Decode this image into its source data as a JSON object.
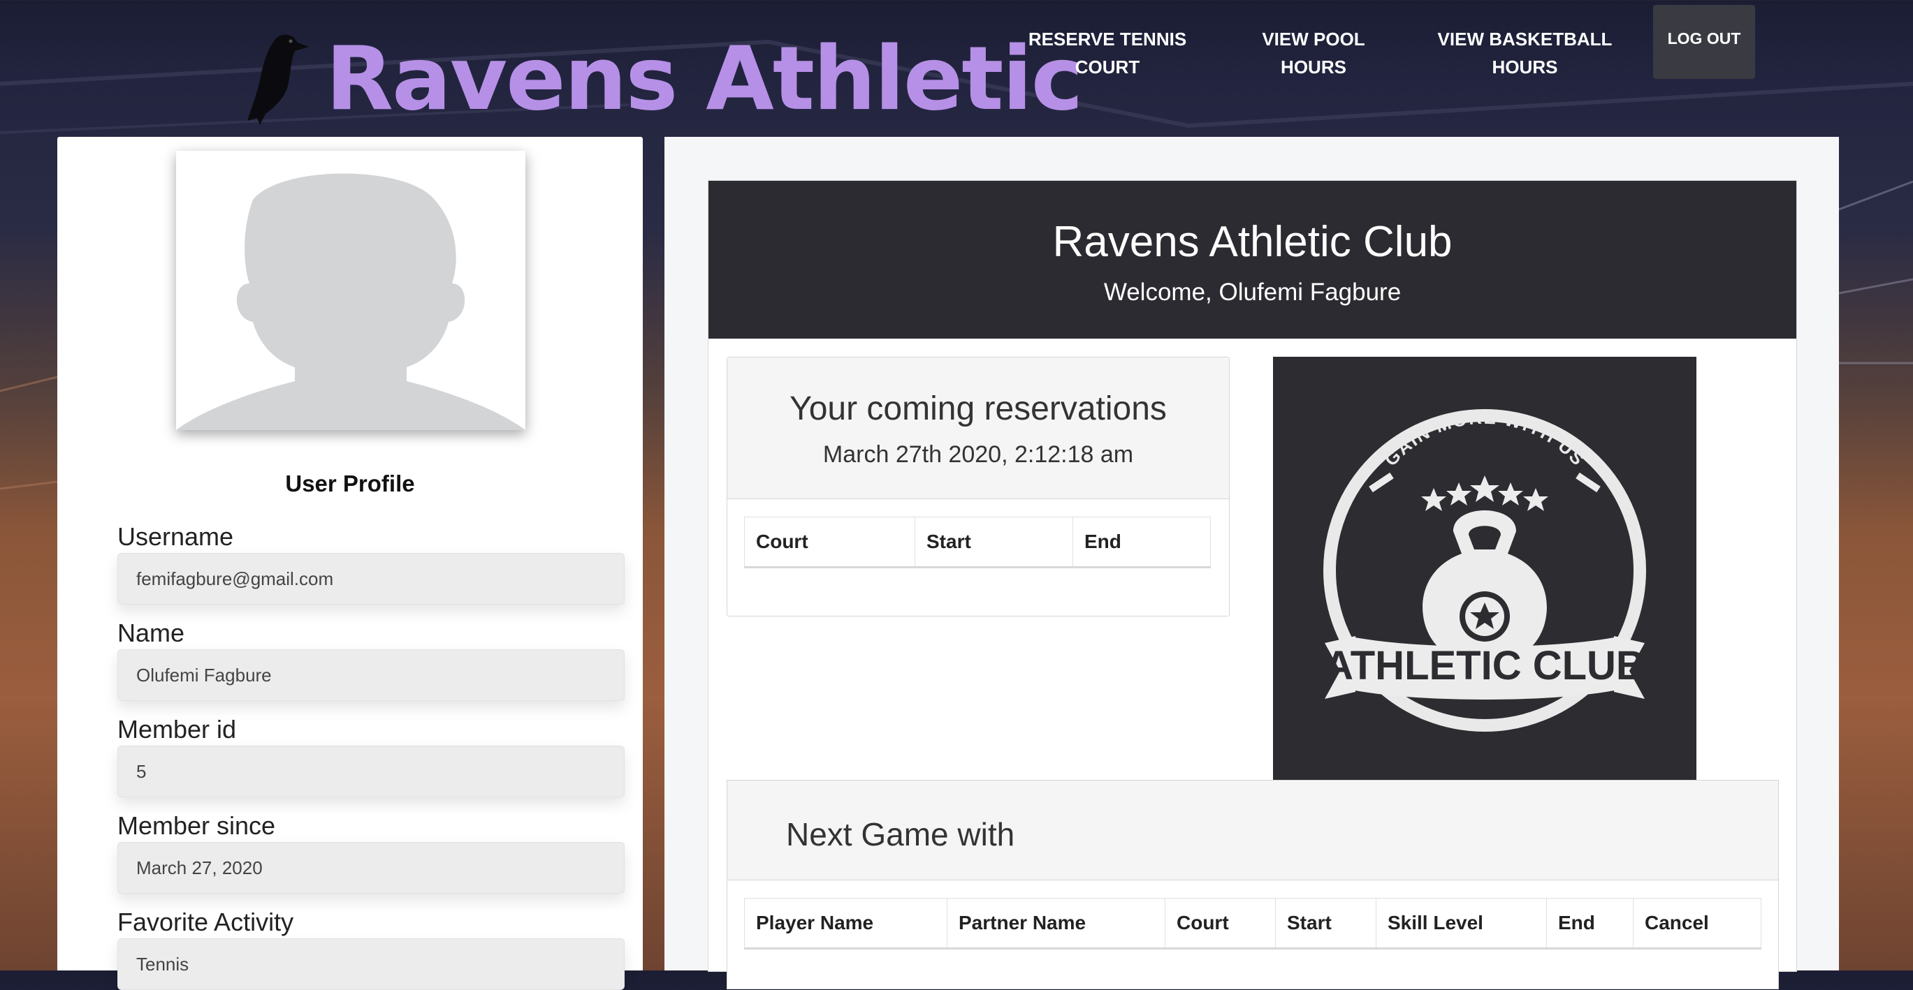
{
  "header": {
    "brand": "Ravens Athletic",
    "nav": {
      "reserve_tennis": "RESERVE TENNIS COURT",
      "view_pool": "VIEW POOL HOURS",
      "view_basketball": "VIEW BASKETBALL HOURS",
      "logout": "LOG OUT"
    }
  },
  "profile": {
    "heading": "User Profile",
    "fields": [
      {
        "label": "Username",
        "value": "femifagbure@gmail.com"
      },
      {
        "label": "Name",
        "value": "Olufemi Fagbure"
      },
      {
        "label": "Member id",
        "value": "5"
      },
      {
        "label": "Member since",
        "value": "March 27, 2020"
      },
      {
        "label": "Favorite Activity",
        "value": "Tennis"
      }
    ]
  },
  "main": {
    "title": "Ravens Athletic Club",
    "welcome": "Welcome, Olufemi Fagbure",
    "reservations": {
      "title": "Your coming reservations",
      "date": "March 27th 2020, 2:12:18 am",
      "columns": [
        "Court",
        "Start",
        "End"
      ]
    },
    "logo": {
      "arc_text": "GAIN MORE WITH US",
      "banner_text": "ATHLETIC CLUB"
    },
    "next_game": {
      "title": "Next Game with",
      "columns": [
        "Player Name",
        "Partner Name",
        "Court",
        "Start",
        "Skill Level",
        "End",
        "Cancel"
      ]
    }
  },
  "colors": {
    "brand": "#b690e6",
    "jumbotron": "#2b2b31",
    "logout_bg": "#3a3b42"
  },
  "icons": [
    "raven-icon",
    "avatar-placeholder-icon",
    "athletic-club-logo"
  ]
}
